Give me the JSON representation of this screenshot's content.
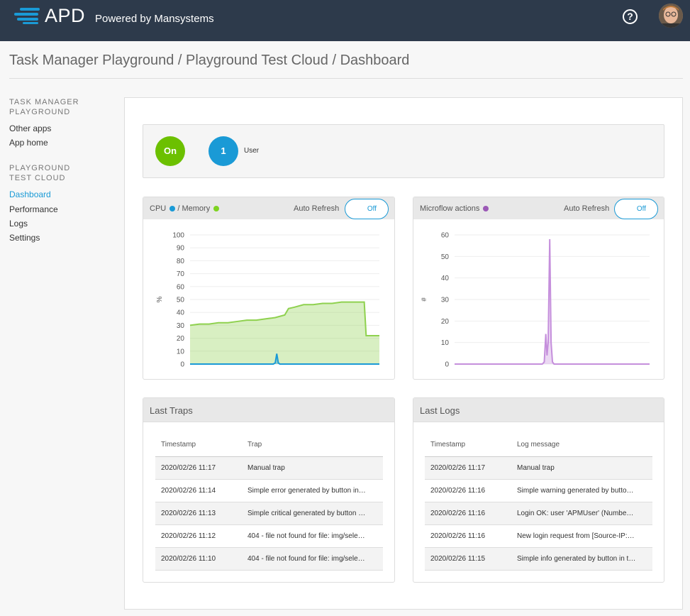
{
  "header": {
    "app_name": "APD",
    "powered_by": "Powered by Mansystems",
    "help_icon": "question-circle-icon",
    "help_label": "?"
  },
  "breadcrumb": "Task Manager Playground / Playground Test Cloud / Dashboard",
  "sidebar": {
    "section1": "TASK MANAGER PLAYGROUND",
    "links1": [
      "Other apps",
      "App home"
    ],
    "section2": "PLAYGROUND TEST CLOUD",
    "links2": [
      "Dashboard",
      "Performance",
      "Logs",
      "Settings"
    ],
    "active": "Dashboard"
  },
  "status": {
    "running": "On",
    "user_count": "1",
    "user_label": "User",
    "running_color": "#6cc000",
    "user_color": "#1a9ad6"
  },
  "cpu_panel": {
    "title_cpu": "CPU",
    "title_memory": "/ Memory",
    "auto_refresh_label": "Auto Refresh",
    "toggle_label": "Off"
  },
  "microflow_panel": {
    "title": "Microflow actions",
    "auto_refresh_label": "Auto Refresh",
    "toggle_label": "Off"
  },
  "chart_data": [
    {
      "type": "area",
      "ylabel": "%",
      "ylim": [
        0,
        100
      ],
      "yticks": [
        0,
        10,
        20,
        30,
        40,
        50,
        60,
        70,
        80,
        90,
        100
      ],
      "series": [
        {
          "name": "Memory",
          "color": "#8fd14f",
          "x": [
            0,
            5,
            10,
            15,
            20,
            25,
            30,
            35,
            40,
            45,
            50,
            52,
            55,
            60,
            65,
            70,
            75,
            80,
            85,
            90,
            92,
            93,
            100
          ],
          "values": [
            30,
            31,
            31,
            32,
            32,
            33,
            34,
            34,
            35,
            36,
            38,
            43,
            44,
            46,
            46,
            47,
            47,
            48,
            48,
            48,
            48,
            22,
            22
          ]
        },
        {
          "name": "CPU",
          "color": "#1a9ad6",
          "x": [
            0,
            44,
            45,
            45.8,
            46.6,
            47.4,
            48,
            100
          ],
          "values": [
            0,
            0,
            1,
            8,
            1,
            0,
            0,
            0
          ]
        }
      ]
    },
    {
      "type": "area",
      "ylabel": "#",
      "ylim": [
        0,
        60
      ],
      "yticks": [
        0,
        10,
        20,
        30,
        40,
        50,
        60
      ],
      "series": [
        {
          "name": "Microflow actions",
          "color": "#c58fdc",
          "x": [
            0,
            45,
            46,
            46.8,
            47.4,
            48,
            48.8,
            49.5,
            50.2,
            51,
            52,
            100
          ],
          "values": [
            0,
            0,
            1,
            14,
            4,
            10,
            58,
            10,
            1,
            0,
            0,
            0
          ]
        }
      ]
    }
  ],
  "last_traps": {
    "title": "Last Traps",
    "columns": [
      "Timestamp",
      "Trap"
    ],
    "rows": [
      [
        "2020/02/26 11:17",
        "Manual trap"
      ],
      [
        "2020/02/26 11:14",
        "Simple error generated by button in…"
      ],
      [
        "2020/02/26 11:13",
        "Simple critical generated by button …"
      ],
      [
        "2020/02/26 11:12",
        "404 - file not found for file: img/sele…"
      ],
      [
        "2020/02/26 11:10",
        "404 - file not found for file: img/sele…"
      ]
    ]
  },
  "last_logs": {
    "title": "Last Logs",
    "columns": [
      "Timestamp",
      "Log message"
    ],
    "rows": [
      [
        "2020/02/26 11:17",
        "Manual trap"
      ],
      [
        "2020/02/26 11:16",
        "Simple warning generated by butto…"
      ],
      [
        "2020/02/26 11:16",
        "Login OK: user 'APMUser' (Numbe…"
      ],
      [
        "2020/02/26 11:16",
        "New login request from [Source-IP:…"
      ],
      [
        "2020/02/26 11:15",
        "Simple info generated by button in t…"
      ]
    ]
  }
}
